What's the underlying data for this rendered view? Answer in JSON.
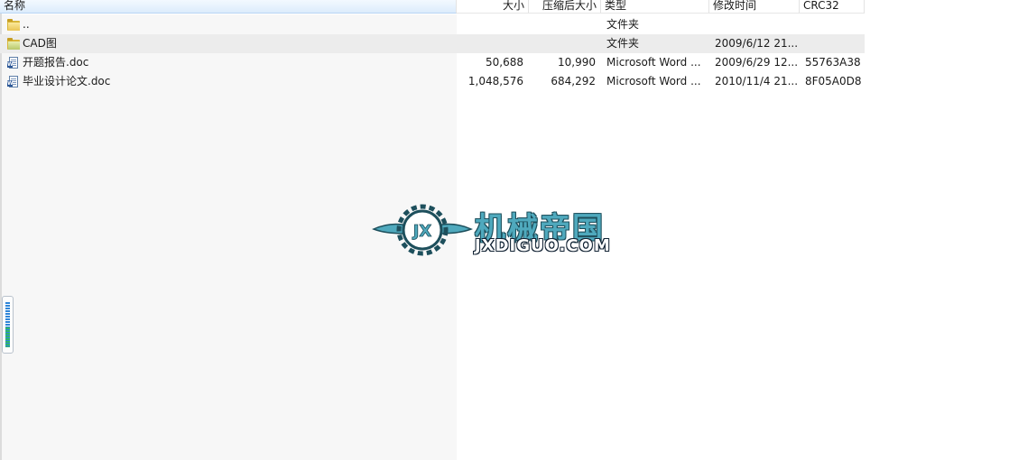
{
  "header": {
    "col_name": "名称",
    "col_size": "大小",
    "col_packed": "压缩后大小",
    "col_type": "类型",
    "col_modified": "修改时间",
    "col_crc": "CRC32"
  },
  "rows": [
    {
      "name": "..",
      "size": "",
      "packed": "",
      "type": "文件夹",
      "modified": "",
      "crc": "",
      "icon": "folder-icon"
    },
    {
      "name": "CAD图",
      "size": "",
      "packed": "",
      "type": "文件夹",
      "modified": "2009/6/12 21...",
      "crc": "",
      "icon": "folder-icon"
    },
    {
      "name": "开题报告.doc",
      "size": "50,688",
      "packed": "10,990",
      "type": "Microsoft Word ...",
      "modified": "2009/6/29 12...",
      "crc": "55763A38",
      "icon": "word-document-icon"
    },
    {
      "name": "毕业设计论文.doc",
      "size": "1,048,576",
      "packed": "684,292",
      "type": "Microsoft Word ...",
      "modified": "2010/11/4 21...",
      "crc": "8F05A0D8",
      "icon": "word-document-icon"
    }
  ],
  "watermark": {
    "title": "机械帝国",
    "subtitle": "JXDIGUO.COM",
    "icon_text": "JX",
    "colors": {
      "main": "#4fa9bd",
      "outline": "#1d4f5c"
    }
  },
  "colors": {
    "header_active": "#dcecfc",
    "row_alt": "#ececec",
    "left_pane": "#f7f7f7"
  }
}
